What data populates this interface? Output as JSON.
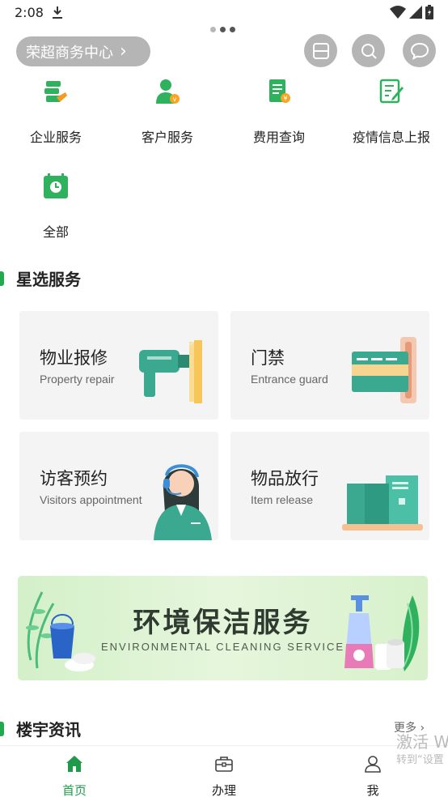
{
  "status_bar": {
    "time": "2:08"
  },
  "header": {
    "location": "荣超商务中心"
  },
  "quick_menu": [
    {
      "label": "企业服务",
      "icon": "enterprise-service-icon"
    },
    {
      "label": "客户服务",
      "icon": "customer-service-icon"
    },
    {
      "label": "费用查询",
      "icon": "fee-query-icon"
    },
    {
      "label": "疫情信息上报",
      "icon": "epidemic-report-icon"
    },
    {
      "label": "全部",
      "icon": "all-calendar-icon"
    }
  ],
  "featured": {
    "title": "星选服务",
    "cards": [
      {
        "title": "物业报修",
        "subtitle": "Property repair"
      },
      {
        "title": "门禁",
        "subtitle": "Entrance guard"
      },
      {
        "title": "访客预约",
        "subtitle": "Visitors appointment"
      },
      {
        "title": "物品放行",
        "subtitle": "Item release"
      }
    ]
  },
  "banner": {
    "title": "环境保洁服务",
    "subtitle": "ENVIRONMENTAL CLEANING SERVICE"
  },
  "news": {
    "title": "楼宇资讯",
    "more": "更多"
  },
  "tabs": [
    {
      "label": "首页",
      "icon": "home-icon"
    },
    {
      "label": "办理",
      "icon": "briefcase-icon"
    },
    {
      "label": "我",
      "icon": "user-icon"
    }
  ],
  "watermark": {
    "line1": "激活 W",
    "line2": "转到“设置"
  },
  "colors": {
    "accent": "#1faa4e",
    "teal": "#3aa98f",
    "pill_bg": "#b5b5b5"
  }
}
